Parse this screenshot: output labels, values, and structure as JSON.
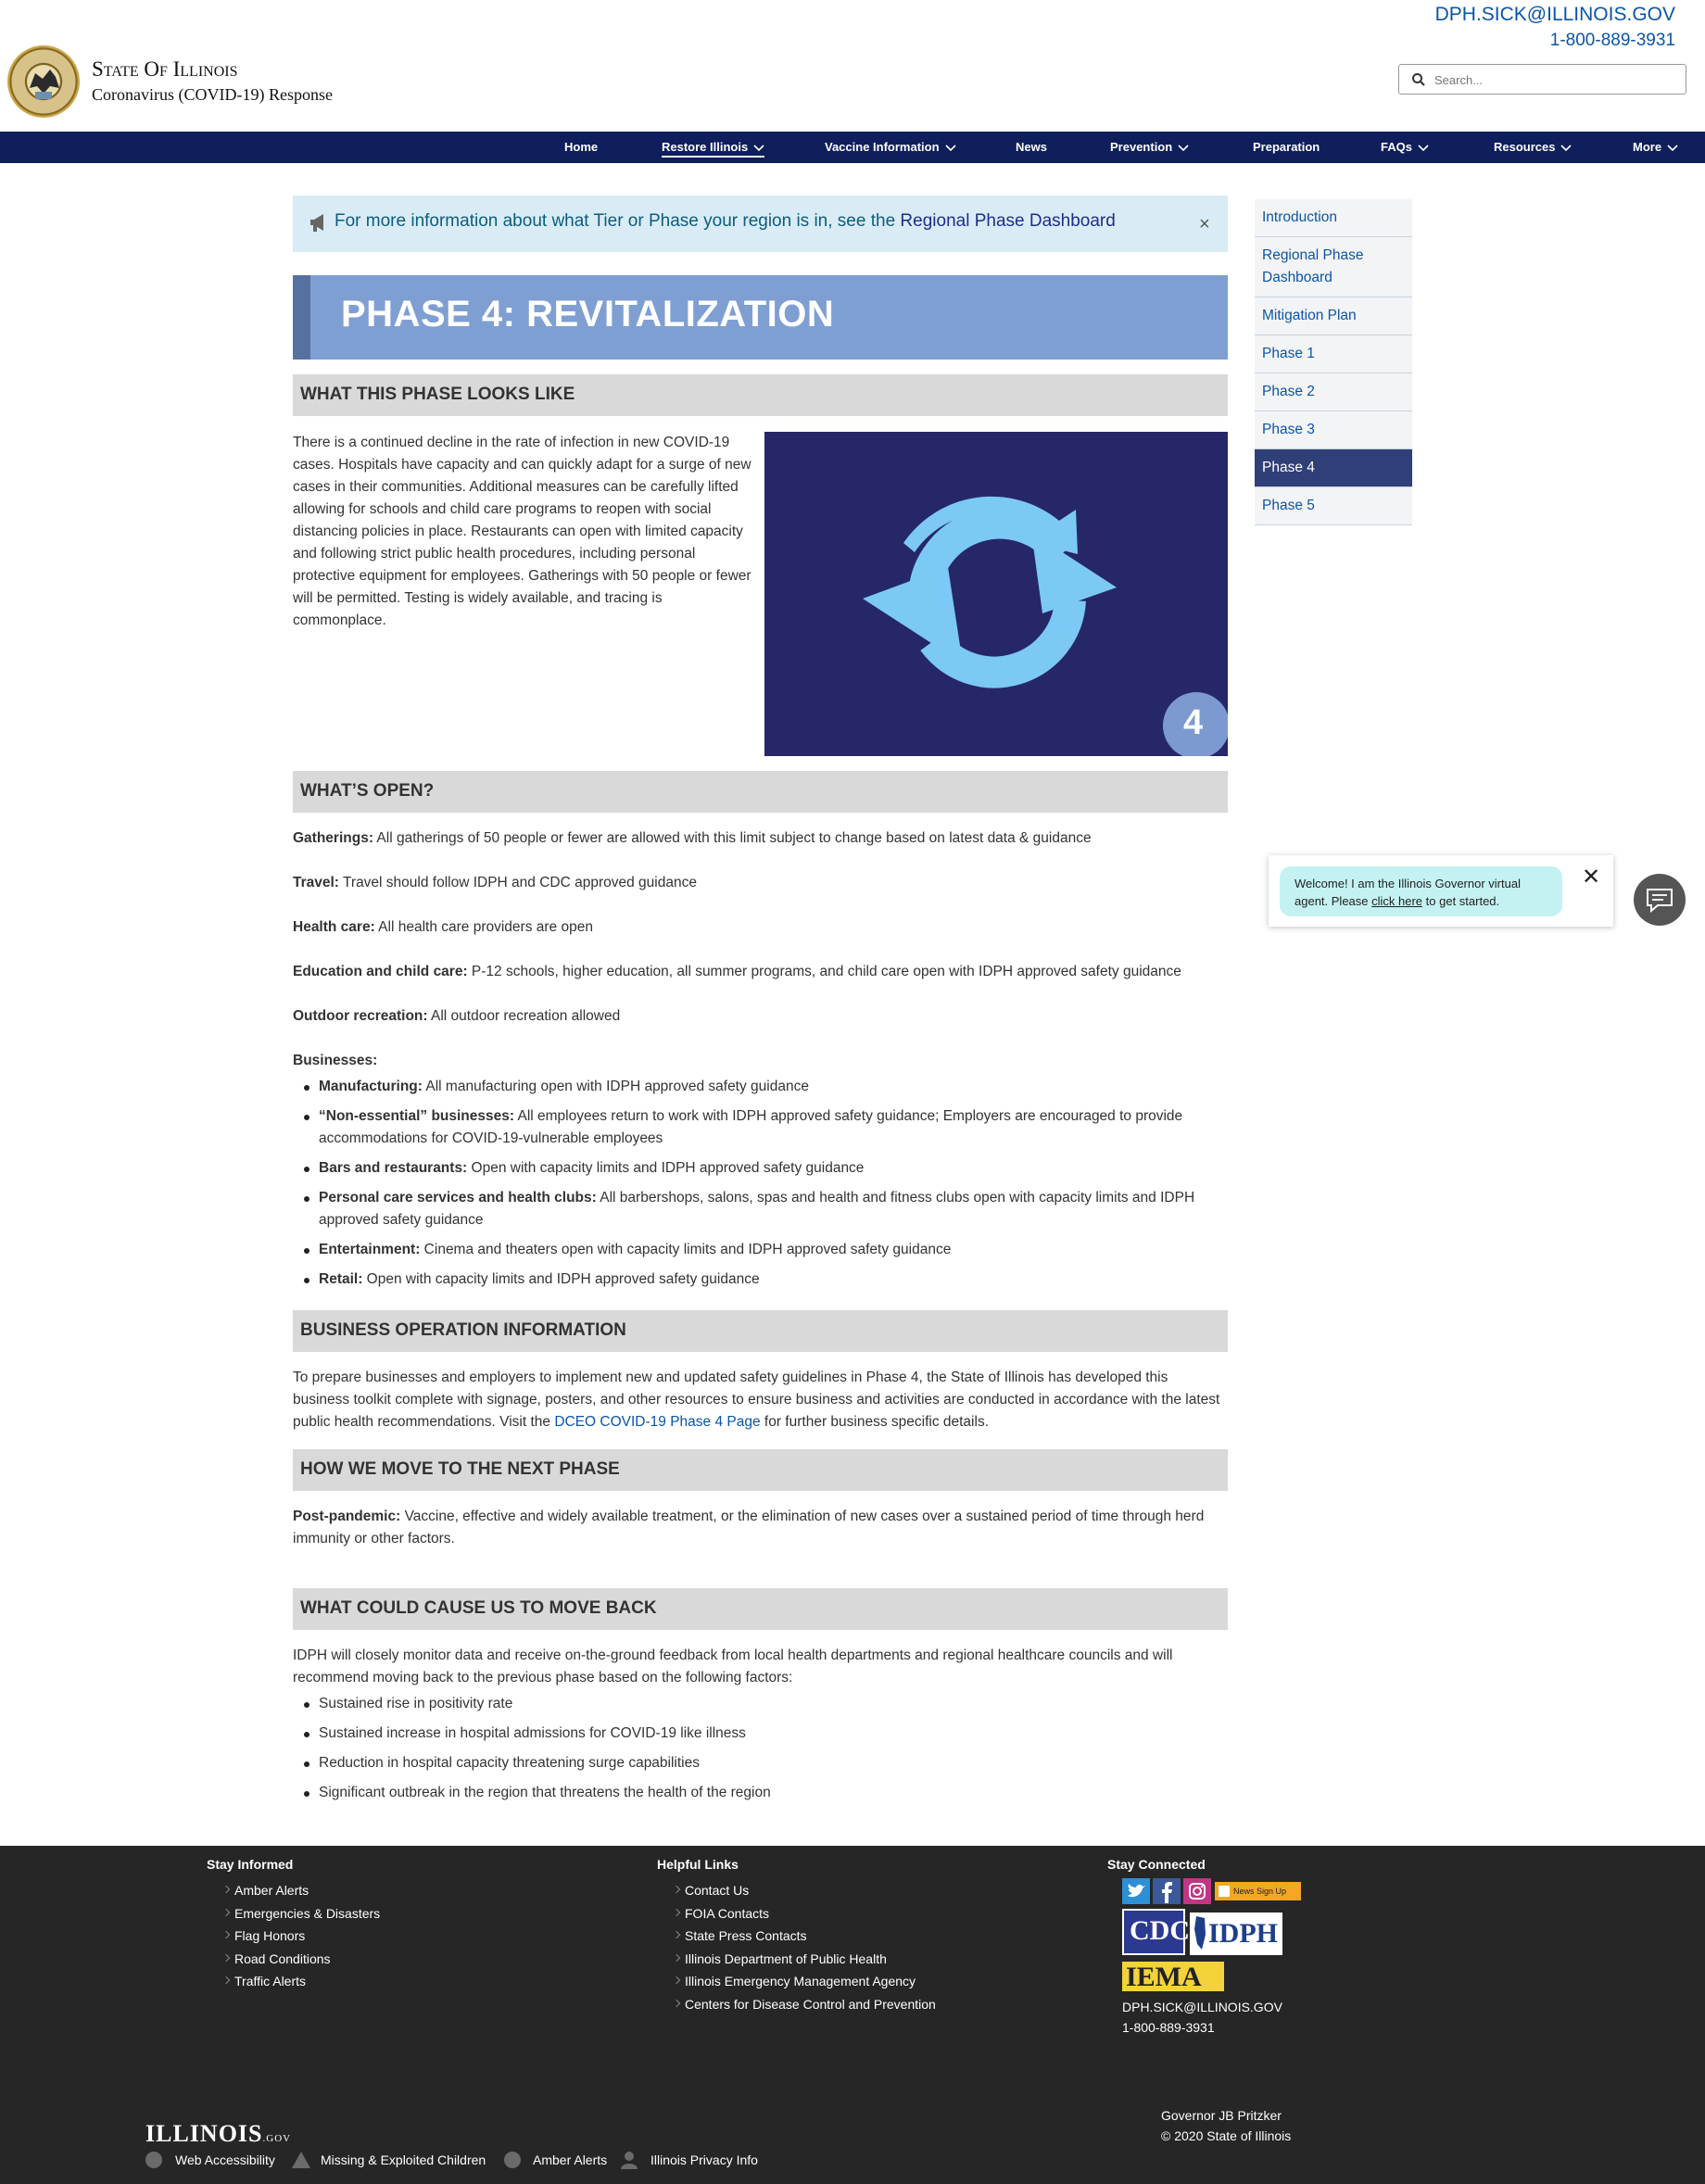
{
  "header": {
    "site_title": "State Of Illinois",
    "site_subtitle": "Coronavirus (COVID-19) Response",
    "email": "DPH.SICK@ILLINOIS.GOV",
    "phone": "1-800-889-3931",
    "search_placeholder": "Search..."
  },
  "nav": {
    "items": [
      {
        "label": "Home"
      },
      {
        "label": "Restore Illinois",
        "active": true
      },
      {
        "label": "Vaccine Information"
      },
      {
        "label": "News"
      },
      {
        "label": "Prevention"
      },
      {
        "label": "Preparation"
      },
      {
        "label": "FAQs"
      },
      {
        "label": "Resources"
      },
      {
        "label": "More"
      }
    ]
  },
  "alert": {
    "text": "For more information about what Tier or Phase your region is in, see the ",
    "link": "Regional Phase Dashboard",
    "close": "×"
  },
  "page_title": "PHASE 4: REVITALIZATION",
  "sections": {
    "looks_like": {
      "heading": "WHAT THIS PHASE LOOKS LIKE",
      "body": "There is a continued decline in the rate of infection in new COVID-19 cases. Hospitals have capacity and can quickly adapt for a surge of new cases in their communities. Additional measures can be carefully lifted allowing for schools and child care programs to reopen with social distancing policies in place. Restaurants can open with limited capacity and following strict public health procedures, including personal protective equipment for employees. Gatherings with 50 people or fewer will be permitted. Testing is widely available, and tracing is commonplace.",
      "badge_number": "4"
    },
    "whats_open": {
      "heading": "WHAT’S OPEN?",
      "items": [
        {
          "label": "Gatherings:",
          "text": " All gatherings of 50 people or fewer are allowed with this limit subject to change based on latest data & guidance"
        },
        {
          "label": "Travel:",
          "text": " Travel should follow IDPH and CDC approved guidance"
        },
        {
          "label": "Health care:",
          "text": " All health care providers are open"
        },
        {
          "label": "Education and child care:",
          "text": " P-12 schools, higher education, all summer programs, and child care open with IDPH approved safety guidance"
        },
        {
          "label": "Outdoor recreation:",
          "text": " All outdoor recreation allowed"
        }
      ],
      "businesses_label": "Businesses:",
      "businesses": [
        {
          "label": "Manufacturing:",
          "text": " All manufacturing open with IDPH approved safety guidance"
        },
        {
          "label": "“Non-essential” businesses:",
          "text": " All employees return to work with IDPH approved safety guidance; Employers are encouraged to provide accommodations for COVID-19-vulnerable employees"
        },
        {
          "label": "Bars and restaurants:",
          "text": " Open with capacity limits and IDPH approved safety guidance"
        },
        {
          "label": "Personal care services and health clubs:",
          "text": " All barbershops, salons, spas and health and fitness clubs open with capacity limits and IDPH approved safety guidance"
        },
        {
          "label": "Entertainment:",
          "text": " Cinema and theaters open with capacity limits and IDPH approved safety guidance"
        },
        {
          "label": "Retail:",
          "text": " Open with capacity limits and IDPH approved safety guidance"
        }
      ]
    },
    "business_info": {
      "heading": "BUSINESS OPERATION INFORMATION",
      "body_before": "To prepare businesses and employers to implement new and updated safety guidelines in Phase 4, the State of Illinois has developed this business toolkit complete with signage, posters, and other resources to ensure business and activities are conducted in accordance with the latest public health recommendations. Visit the ",
      "link": "DCEO COVID-19 Phase 4 Page",
      "body_after": " for further business specific details."
    },
    "next_phase": {
      "heading": "HOW WE MOVE TO THE NEXT PHASE",
      "label": "Post-pandemic:",
      "text": " Vaccine, effective and widely available treatment, or the elimination of new cases over a sustained period of time through herd immunity or other factors."
    },
    "move_back": {
      "heading": "WHAT COULD CAUSE US TO MOVE BACK",
      "intro": "IDPH will closely monitor data and receive on-the-ground feedback from local health departments and regional healthcare councils and will recommend moving back to the previous phase based on the following factors:",
      "factors": [
        "Sustained rise in positivity rate",
        "Sustained increase in hospital admissions for COVID-19 like illness",
        "Reduction in hospital capacity threatening surge capabilities",
        "Significant outbreak in the region that threatens the health of the region"
      ]
    }
  },
  "sidenav": {
    "items": [
      {
        "label": "Introduction"
      },
      {
        "label": "Regional Phase Dashboard"
      },
      {
        "label": "Mitigation Plan"
      },
      {
        "label": "Phase 1"
      },
      {
        "label": "Phase 2"
      },
      {
        "label": "Phase 3"
      },
      {
        "label": "Phase 4",
        "active": true
      },
      {
        "label": "Phase 5"
      }
    ]
  },
  "chat": {
    "message_before": "Welcome! I am the Illinois Governor virtual agent. Please ",
    "link": "click here",
    "message_after": " to get started.",
    "close": "✕"
  },
  "footer": {
    "stay_informed": {
      "title": "Stay Informed",
      "links": [
        "Amber Alerts",
        "Emergencies & Disasters",
        "Flag Honors",
        "Road Conditions",
        "Traffic Alerts"
      ]
    },
    "helpful_links": {
      "title": "Helpful Links",
      "links": [
        "Contact Us",
        "FOIA Contacts",
        "State Press Contacts",
        "Illinois Department of Public Health",
        "Illinois Emergency Management Agency",
        "Centers for Disease Control and Prevention"
      ]
    },
    "stay_connected": {
      "title": "Stay Connected",
      "news_signup": "News Sign Up",
      "cdc": "CDC",
      "idph": "IDPH",
      "iema": "IEMA",
      "email": "DPH.SICK@ILLINOIS.GOV",
      "phone": "1-800-889-3931"
    },
    "governor": "Governor JB Pritzker",
    "copyright": "© 2020 State of Illinois",
    "logo": "ILLINOIS",
    "logo_suffix": ".GOV",
    "bottom_links": [
      "Web Accessibility",
      "Missing & Exploited Children",
      "Amber Alerts",
      "Illinois Privacy Info"
    ]
  },
  "colors": {
    "nav_bg": "#0e1f5c",
    "link": "#0a55a7",
    "phase_banner": "#7f9fd2",
    "hero_bg": "#262769",
    "refresh_icon": "#7bc9f4",
    "sidenav_active": "#2f3f77",
    "footer_bg": "#262626"
  }
}
